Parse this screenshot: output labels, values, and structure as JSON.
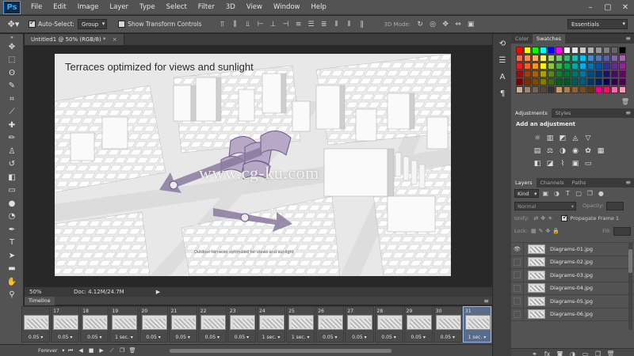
{
  "app": {
    "logo": "Ps",
    "menu": [
      "File",
      "Edit",
      "Image",
      "Layer",
      "Type",
      "Select",
      "Filter",
      "3D",
      "View",
      "Window",
      "Help"
    ],
    "window_controls": [
      "–",
      "▢",
      "✕"
    ]
  },
  "options_bar": {
    "auto_select_label": "Auto-Select:",
    "auto_select_value": "Group",
    "show_transform_label": "Show Transform Controls",
    "mode_label": "3D Mode:",
    "workspace": "Essentials"
  },
  "document": {
    "tab_label": "Untitled1 @ 50% (RGB/8) *",
    "tab_close": "×",
    "canvas_title": "Terraces optimized for views and sunlight",
    "canvas_caption": "Outdoor terraces optimized for views and sunlight",
    "watermark": "www.cg-ku.com"
  },
  "status_bar": {
    "zoom": "50%",
    "doc_info": "Doc: 4.12M/24.7M",
    "arrow": "▶"
  },
  "timeline": {
    "tab_label": "Timeline",
    "loop": "Forever",
    "frames": [
      {
        "num": "",
        "delay": "0.05 ▾"
      },
      {
        "num": "17",
        "delay": "0.05 ▾"
      },
      {
        "num": "18",
        "delay": "0.05 ▾"
      },
      {
        "num": "19",
        "delay": "1 sec. ▾"
      },
      {
        "num": "20",
        "delay": "0.05 ▾"
      },
      {
        "num": "21",
        "delay": "0.05 ▾"
      },
      {
        "num": "22",
        "delay": "0.05 ▾"
      },
      {
        "num": "23",
        "delay": "0.05 ▾"
      },
      {
        "num": "24",
        "delay": "1 sec. ▾"
      },
      {
        "num": "25",
        "delay": "1 sec. ▾"
      },
      {
        "num": "26",
        "delay": "0.05 ▾"
      },
      {
        "num": "27",
        "delay": "0.05 ▾"
      },
      {
        "num": "28",
        "delay": "0.05 ▾"
      },
      {
        "num": "29",
        "delay": "0.05 ▾"
      },
      {
        "num": "30",
        "delay": "0.05 ▾"
      },
      {
        "num": "31",
        "delay": "1 sec. ▾"
      }
    ]
  },
  "color_panel": {
    "tabs": [
      "Color",
      "Swatches"
    ],
    "swatch_colors": [
      "#ff0000",
      "#ffff00",
      "#00ff00",
      "#00ffff",
      "#0000ff",
      "#ff00ff",
      "#ffffff",
      "#e6e6e6",
      "#cccccc",
      "#b3b3b3",
      "#999999",
      "#808080",
      "#666666",
      "#000000",
      "#f26c4f",
      "#f68e55",
      "#fbaf5c",
      "#fff467",
      "#acd372",
      "#7cc576",
      "#3bb878",
      "#1abbb4",
      "#00bff3",
      "#438ccb",
      "#5574b9",
      "#605ca8",
      "#855fa8",
      "#a763a8",
      "#ed1c24",
      "#f26522",
      "#f7941d",
      "#fff200",
      "#8dc63f",
      "#39b54a",
      "#00a651",
      "#00a99d",
      "#00aeef",
      "#0072bc",
      "#0054a6",
      "#2e3192",
      "#662d91",
      "#92278f",
      "#9e0b0f",
      "#a0410d",
      "#a36209",
      "#aba000",
      "#598527",
      "#197b30",
      "#007236",
      "#00746b",
      "#0076a3",
      "#004b80",
      "#003471",
      "#1b1464",
      "#440e62",
      "#630460",
      "#790000",
      "#7b2e00",
      "#7d4900",
      "#827b00",
      "#406618",
      "#005e20",
      "#005826",
      "#005952",
      "#005b7f",
      "#003663",
      "#002157",
      "#0d004c",
      "#32004b",
      "#4b0049",
      "#c7b299",
      "#998675",
      "#736357",
      "#534741",
      "#37302d",
      "#c69c6d",
      "#a67c52",
      "#8c6239",
      "#754c24",
      "#603913",
      "#ec008c",
      "#ed145b",
      "#f06eaa",
      "#f49ac2"
    ]
  },
  "adjustments_panel": {
    "tabs": [
      "Adjustments",
      "Styles"
    ],
    "heading": "Add an adjustment",
    "row1_icons": [
      "☼",
      "▥",
      "◩",
      "◬",
      "▽"
    ],
    "row2_icons": [
      "▤",
      "⚖",
      "◑",
      "◉",
      "✿",
      "▦"
    ],
    "row3_icons": [
      "◧",
      "◪",
      "⌇",
      "▣",
      "▭"
    ]
  },
  "layers_panel": {
    "tabs": [
      "Layers",
      "Channels",
      "Paths"
    ],
    "kind": "Kind",
    "blend_mode": "Normal",
    "opacity_label": "Opacity:",
    "unify_label": "Unify:",
    "propagate_label": "Propagate Frame 1",
    "lock_label": "Lock:",
    "fill_label": "Fill:",
    "layers": [
      {
        "name": "Diagrams-01.jpg",
        "visible": true
      },
      {
        "name": "Diagrams-02.jpg",
        "visible": false
      },
      {
        "name": "Diagrams-03.jpg",
        "visible": false
      },
      {
        "name": "Diagrams-04.jpg",
        "visible": false
      },
      {
        "name": "Diagrams-05.jpg",
        "visible": false
      },
      {
        "name": "Diagrams-06.jpg",
        "visible": false
      }
    ]
  }
}
